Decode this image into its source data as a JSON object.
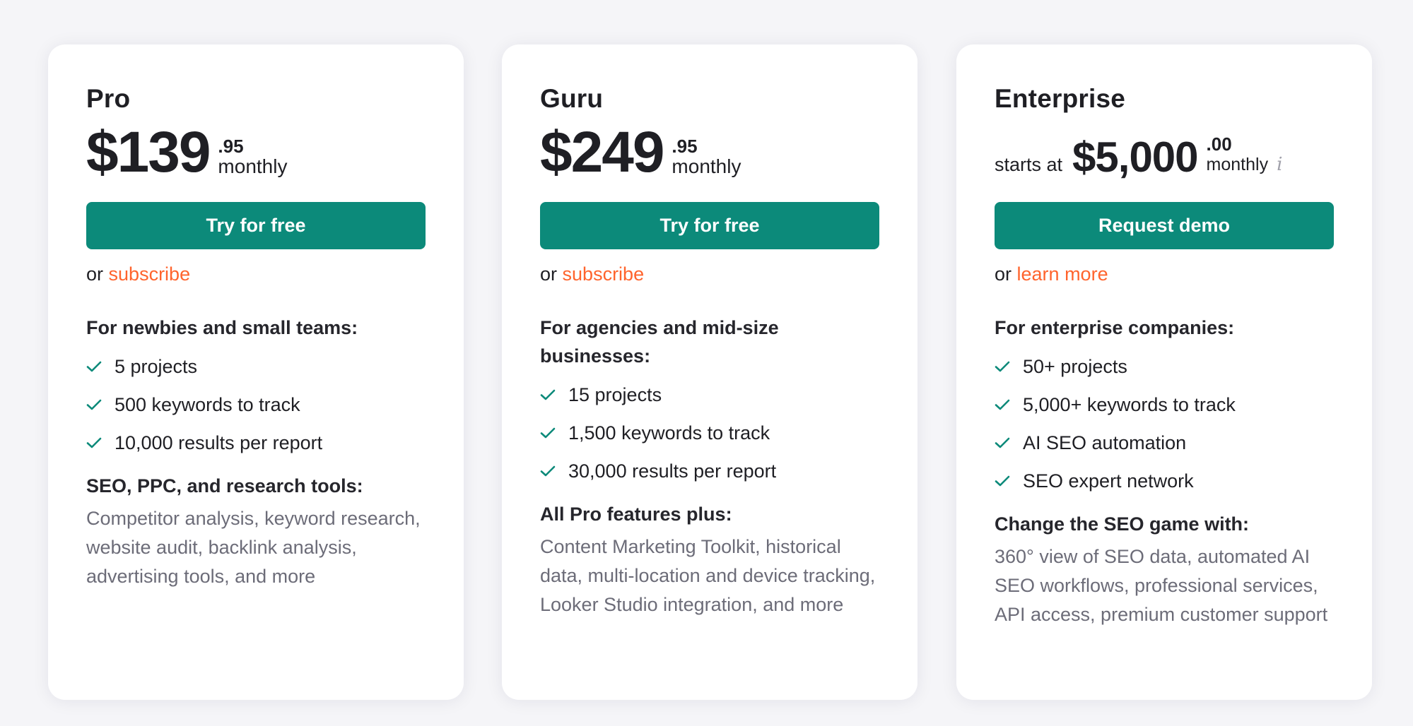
{
  "colors": {
    "accent": "#0c8a7a",
    "link": "#ff642d",
    "muted_text": "#6c6c78",
    "check": "#0c8a7a",
    "info_icon": "#a0a0aa"
  },
  "plans": [
    {
      "name": "Pro",
      "price": "$139",
      "cents": ".95",
      "period": "monthly",
      "cta_label": "Try for free",
      "alt_prefix": "or",
      "alt_link": "subscribe",
      "audience": "For newbies and small teams:",
      "features": [
        "5 projects",
        "500 keywords to track",
        "10,000 results per report"
      ],
      "subheading": "SEO, PPC, and research tools:",
      "description": "Competitor analysis, keyword research, website audit, backlink analysis, advertising tools, and more"
    },
    {
      "name": "Guru",
      "price": "$249",
      "cents": ".95",
      "period": "monthly",
      "cta_label": "Try for free",
      "alt_prefix": "or",
      "alt_link": "subscribe",
      "audience": "For agencies and mid-size businesses:",
      "features": [
        "15 projects",
        "1,500 keywords to track",
        "30,000 results per report"
      ],
      "subheading": "All Pro features plus:",
      "description": "Content Marketing Toolkit, historical data, multi-location and device tracking, Looker Studio integration, and more"
    },
    {
      "name": "Enterprise",
      "price_prefix": "starts at",
      "price": "$5,000",
      "cents": ".00",
      "period": "monthly",
      "info_icon": "i",
      "cta_label": "Request demo",
      "alt_prefix": "or",
      "alt_link": "learn more",
      "audience": "For enterprise companies:",
      "features": [
        "50+ projects",
        "5,000+ keywords to track",
        "AI SEO automation",
        "SEO expert network"
      ],
      "subheading": "Change the SEO game with:",
      "description": "360° view of SEO data, automated AI SEO workflows, professional services, API access, premium customer support"
    }
  ]
}
